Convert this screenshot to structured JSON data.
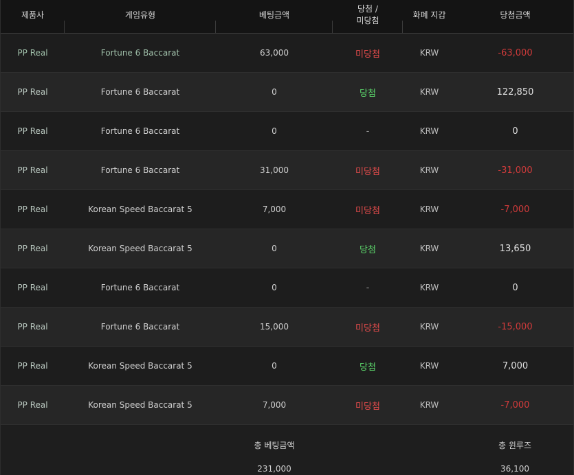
{
  "headers": {
    "provider": "제품사",
    "game_type": "게임유형",
    "bet_amount": "베팅금액",
    "result_line1": "당첨 /",
    "result_line2": "미당첨",
    "currency": "화폐 지갑",
    "win_amount": "당첨금액"
  },
  "rows": [
    {
      "provider": "PP Real",
      "game": "Fortune 6 Baccarat",
      "bet": "63,000",
      "result": "미당첨",
      "currency": "KRW",
      "win": "-63,000"
    },
    {
      "provider": "PP Real",
      "game": "Fortune 6 Baccarat",
      "bet": "0",
      "result": "당첨",
      "currency": "KRW",
      "win": "122,850"
    },
    {
      "provider": "PP Real",
      "game": "Fortune 6 Baccarat",
      "bet": "0",
      "result": "-",
      "currency": "KRW",
      "win": "0"
    },
    {
      "provider": "PP Real",
      "game": "Fortune 6 Baccarat",
      "bet": "31,000",
      "result": "미당첨",
      "currency": "KRW",
      "win": "-31,000"
    },
    {
      "provider": "PP Real",
      "game": "Korean Speed Baccarat 5",
      "bet": "7,000",
      "result": "미당첨",
      "currency": "KRW",
      "win": "-7,000"
    },
    {
      "provider": "PP Real",
      "game": "Korean Speed Baccarat 5",
      "bet": "0",
      "result": "당첨",
      "currency": "KRW",
      "win": "13,650"
    },
    {
      "provider": "PP Real",
      "game": "Fortune 6 Baccarat",
      "bet": "0",
      "result": "-",
      "currency": "KRW",
      "win": "0"
    },
    {
      "provider": "PP Real",
      "game": "Fortune 6 Baccarat",
      "bet": "15,000",
      "result": "미당첨",
      "currency": "KRW",
      "win": "-15,000"
    },
    {
      "provider": "PP Real",
      "game": "Korean Speed Baccarat 5",
      "bet": "0",
      "result": "당첨",
      "currency": "KRW",
      "win": "7,000"
    },
    {
      "provider": "PP Real",
      "game": "Korean Speed Baccarat 5",
      "bet": "7,000",
      "result": "미당첨",
      "currency": "KRW",
      "win": "-7,000"
    }
  ],
  "summary": {
    "total_bet_label": "총 베팅금액",
    "total_bet_value": "231,000",
    "total_winloss_label": "총 윈루즈",
    "total_winloss_value": "36,100"
  },
  "colors": {
    "win": "#5bd36a",
    "lose": "#e14b4b",
    "negative_amount": "#d23b3b"
  }
}
